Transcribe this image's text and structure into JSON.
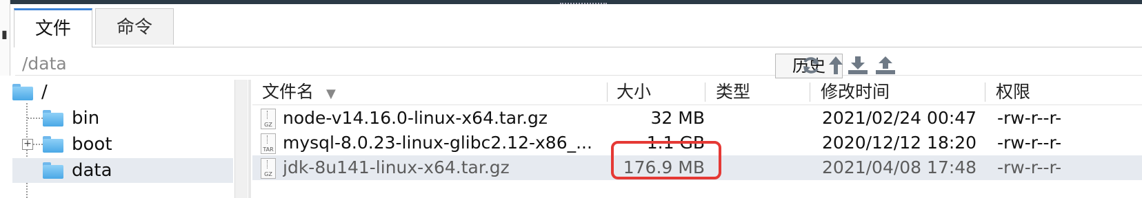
{
  "tabs": [
    {
      "label": "文件",
      "active": true
    },
    {
      "label": "命令",
      "active": false
    }
  ],
  "path": {
    "value": "/data"
  },
  "toolbar": {
    "history_label": "历史",
    "icons": [
      "refresh-icon",
      "up-arrow-icon",
      "download-icon",
      "upload-icon"
    ]
  },
  "tree": {
    "root": "/",
    "items": [
      {
        "label": "bin",
        "expandable": false,
        "selected": false
      },
      {
        "label": "boot",
        "expandable": true,
        "selected": false
      },
      {
        "label": "data",
        "expandable": false,
        "selected": true
      }
    ]
  },
  "table": {
    "columns": [
      "文件名",
      "大小",
      "类型",
      "修改时间",
      "权限"
    ],
    "sort_indicator": "▼",
    "rows": [
      {
        "icon_tag": "GZ",
        "name": "node-v14.16.0-linux-x64.tar.gz",
        "size": "32 MB",
        "type": "",
        "modified": "2021/02/24 00:47",
        "perm": "-rw-r--r-",
        "selected": false
      },
      {
        "icon_tag": "TAR",
        "name": "mysql-8.0.23-linux-glibc2.12-x86_...",
        "size": "1.1 GB",
        "type": "",
        "modified": "2020/12/12 18:20",
        "perm": "-rw-r--r-",
        "selected": false
      },
      {
        "icon_tag": "GZ",
        "name": "jdk-8u141-linux-x64.tar.gz",
        "size": "176.9 MB",
        "type": "",
        "modified": "2021/04/08 17:48",
        "perm": "-rw-r--r-",
        "selected": true
      }
    ]
  },
  "colors": {
    "accent": "#3b82d6",
    "highlight_box": "#e53935",
    "selection": "#e6eaf0",
    "folder": "#4aa8e6"
  }
}
